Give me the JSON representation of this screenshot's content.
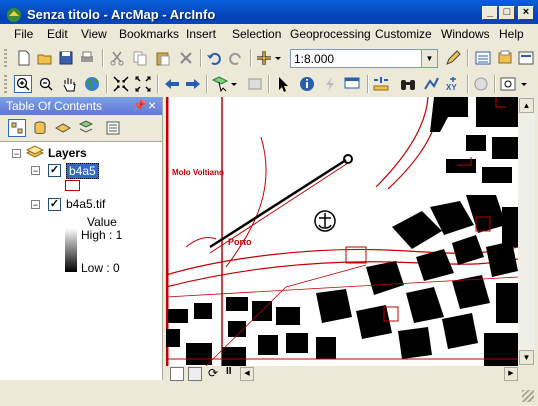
{
  "window": {
    "title": "Senza titolo - ArcMap - ArcInfo"
  },
  "menu": [
    "File",
    "Edit",
    "View",
    "Bookmarks",
    "Insert",
    "Selection",
    "Geoprocessing",
    "Customize",
    "Windows",
    "Help"
  ],
  "toolbar": {
    "scale_value": "1:8.000"
  },
  "toc": {
    "title": "Table Of Contents",
    "layers_label": "Layers",
    "layer1_name": "b4a5",
    "layer2_name": "b4a5.tif",
    "legend_value": "Value",
    "legend_high": "High : 1",
    "legend_low": "Low : 0"
  },
  "map": {
    "labels": [
      "Porto",
      "Molo Voltiano"
    ],
    "line_color": "#c00000",
    "fill_color": "#000000"
  }
}
